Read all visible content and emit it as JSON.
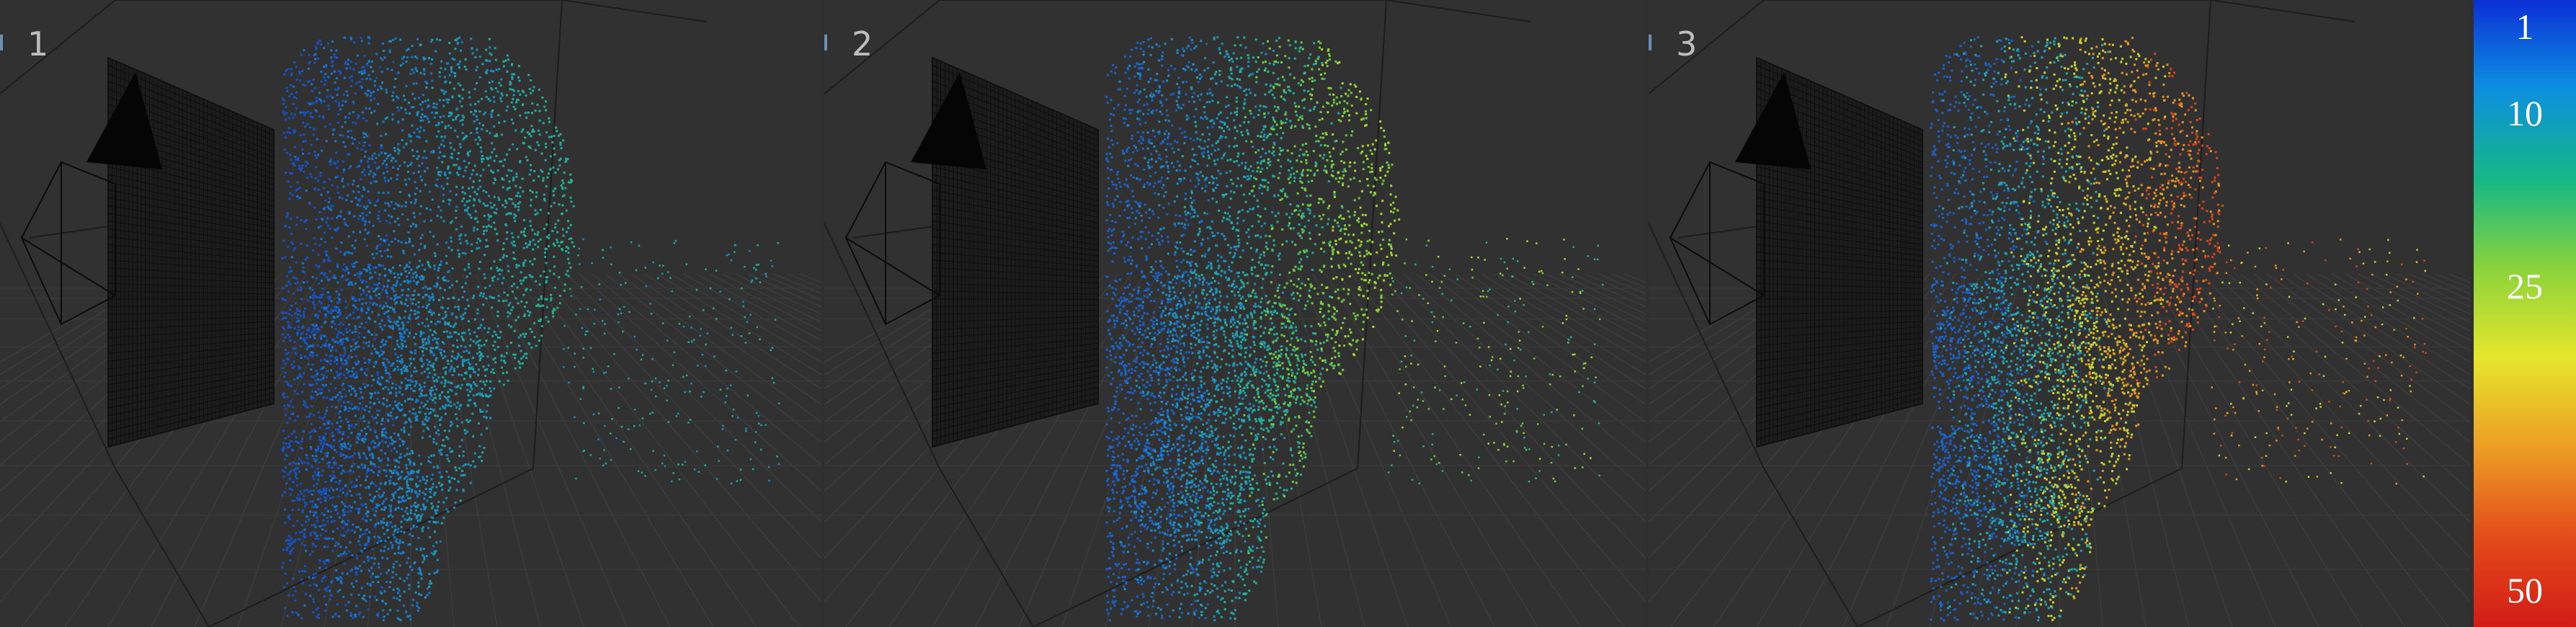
{
  "viewports": [
    {
      "label": "1",
      "palette": [
        "#1554c8",
        "#1677cf",
        "#1990c0",
        "#1ea6a8",
        "#22b38e"
      ]
    },
    {
      "label": "2",
      "palette": [
        "#1a62cc",
        "#1b8ec6",
        "#22b09a",
        "#6fcb3e",
        "#a8d82c"
      ]
    },
    {
      "label": "3",
      "palette": [
        "#1a62cc",
        "#22a5b0",
        "#c8d22c",
        "#e8961e",
        "#d8481a"
      ]
    }
  ],
  "colorbar": {
    "labels": [
      "1",
      "10",
      "25",
      "50"
    ],
    "colors": [
      "#0c2fd6",
      "#0c8fe0",
      "#18b884",
      "#8cd33a",
      "#e6e62c",
      "#eca024",
      "#e34a1a",
      "#d21c16"
    ]
  }
}
